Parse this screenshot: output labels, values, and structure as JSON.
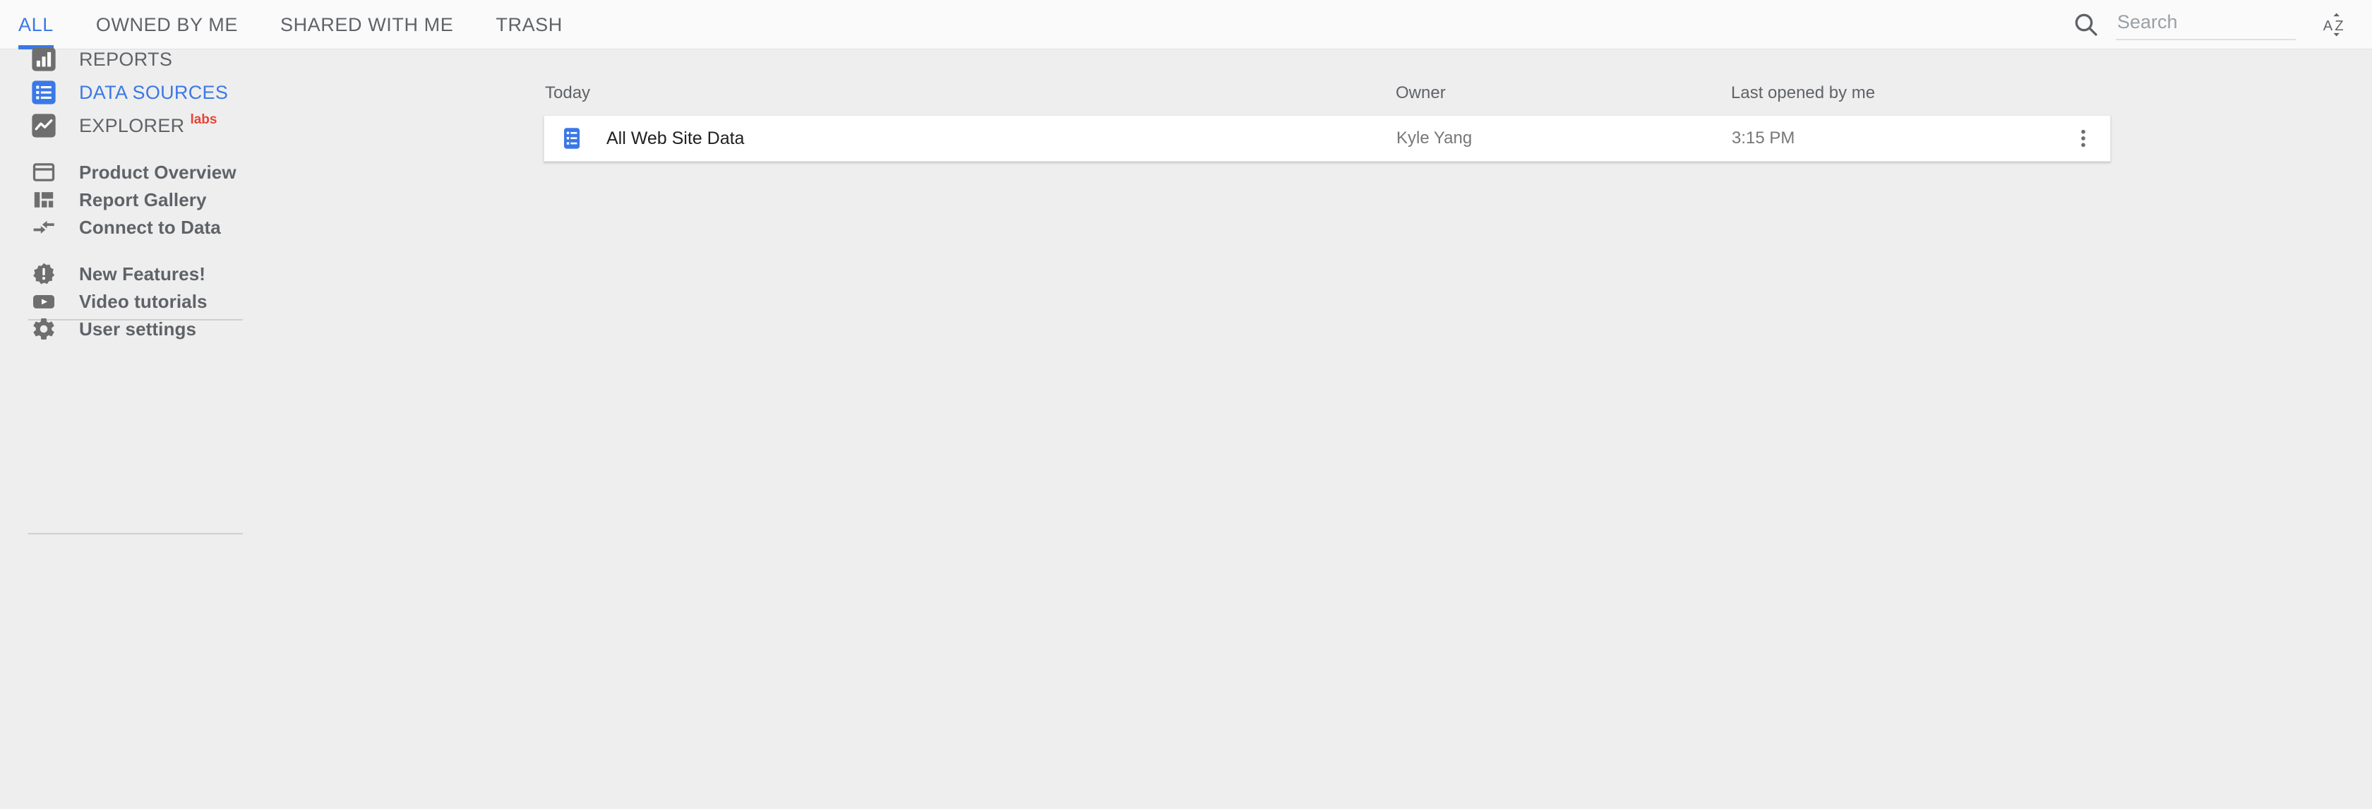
{
  "topbar": {
    "tabs": [
      {
        "label": "ALL",
        "active": true
      },
      {
        "label": "OWNED BY ME",
        "active": false
      },
      {
        "label": "SHARED WITH ME",
        "active": false
      },
      {
        "label": "TRASH",
        "active": false
      }
    ],
    "search": {
      "placeholder": "Search",
      "value": "",
      "icon": "search-icon"
    },
    "sort": {
      "icon": "sort-alpha-az-icon",
      "label": "AZ"
    }
  },
  "sidebar": {
    "primary_items": [
      {
        "label": "REPORTS",
        "icon": "bar-chart-icon",
        "selected": false,
        "badge": ""
      },
      {
        "label": "DATA SOURCES",
        "icon": "data-source-list-icon",
        "selected": true,
        "badge": ""
      },
      {
        "label": "EXPLORER",
        "icon": "trend-line-icon",
        "selected": false,
        "badge": "labs"
      }
    ],
    "secondary_items": [
      {
        "label": "Product Overview",
        "icon": "window-outline-icon"
      },
      {
        "label": "Report Gallery",
        "icon": "dashboard-grid-icon"
      },
      {
        "label": "Connect to Data",
        "icon": "connect-arrows-icon"
      }
    ],
    "tertiary_items": [
      {
        "label": "New Features!",
        "icon": "new-release-badge-icon"
      },
      {
        "label": "Video tutorials",
        "icon": "youtube-play-icon"
      },
      {
        "label": "User settings",
        "icon": "gear-icon"
      }
    ]
  },
  "main": {
    "columns": {
      "group": "Today",
      "owner": "Owner",
      "last_opened": "Last opened by me"
    },
    "rows": [
      {
        "icon": "data-source-list-icon",
        "title": "All Web Site Data",
        "owner": "Kyle Yang",
        "last_opened": "3:15 PM",
        "menu_icon": "more-vert-icon"
      }
    ]
  },
  "colors": {
    "accent_blue": "#3B78E7",
    "icon_gray": "#6E6E6E",
    "labs_red": "#EA4335",
    "page_bg": "#EEEEEE",
    "topbar_bg": "#FAFAFA",
    "card_bg": "#FFFFFF"
  }
}
